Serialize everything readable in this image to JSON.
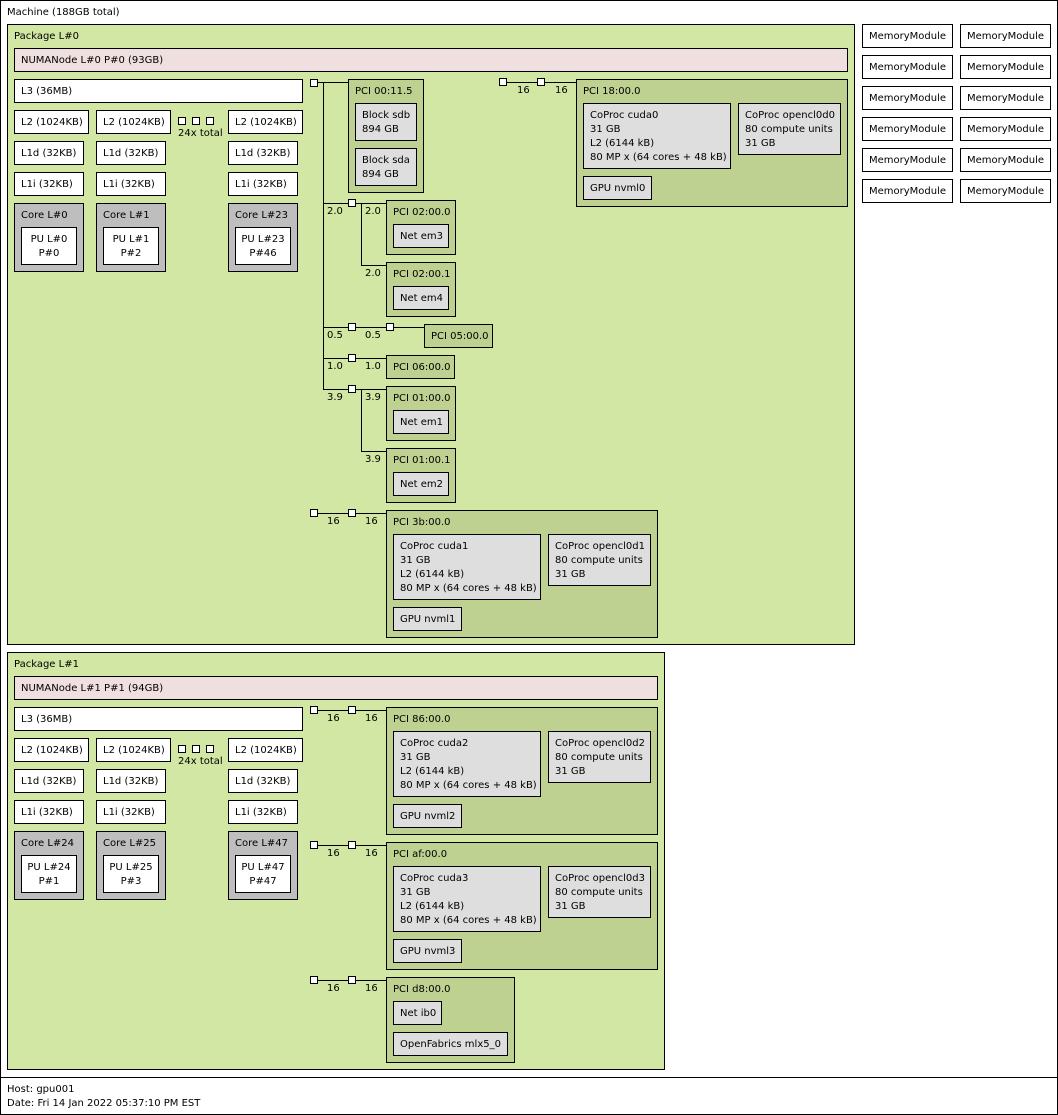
{
  "machine": {
    "title": "Machine (188GB total)"
  },
  "memory_modules": {
    "label": "MemoryModule"
  },
  "packages": [
    {
      "title": "Package L#0",
      "numa": "NUMANode L#0 P#0 (93GB)",
      "l3": "L3 (36MB)",
      "l2": [
        "L2 (1024KB)",
        "L2 (1024KB)",
        "L2 (1024KB)"
      ],
      "l1d": [
        "L1d (32KB)",
        "L1d (32KB)",
        "L1d (32KB)"
      ],
      "l1i": [
        "L1i (32KB)",
        "L1i (32KB)",
        "L1i (32KB)"
      ],
      "total": "24x total",
      "cores": [
        {
          "core": "Core L#0",
          "pu": "PU L#0",
          "p": "P#0"
        },
        {
          "core": "Core L#1",
          "pu": "PU L#1",
          "p": "P#2"
        },
        {
          "core": "Core L#23",
          "pu": "PU L#23",
          "p": "P#46"
        }
      ]
    },
    {
      "title": "Package L#1",
      "numa": "NUMANode L#1 P#1 (94GB)",
      "l3": "L3 (36MB)",
      "l2": [
        "L2 (1024KB)",
        "L2 (1024KB)",
        "L2 (1024KB)"
      ],
      "l1d": [
        "L1d (32KB)",
        "L1d (32KB)",
        "L1d (32KB)"
      ],
      "l1i": [
        "L1i (32KB)",
        "L1i (32KB)",
        "L1i (32KB)"
      ],
      "total": "24x total",
      "cores": [
        {
          "core": "Core L#24",
          "pu": "PU L#24",
          "p": "P#1"
        },
        {
          "core": "Core L#25",
          "pu": "PU L#25",
          "p": "P#3"
        },
        {
          "core": "Core L#47",
          "pu": "PU L#47",
          "p": "P#47"
        }
      ]
    }
  ],
  "pci": {
    "p0011": {
      "title": "PCI 00:11.5",
      "sdb": "Block sdb\n894 GB",
      "sda": "Block sda\n894 GB"
    },
    "p1800": {
      "title": "PCI 18:00.0",
      "cuda": "CoProc cuda0\n31 GB\nL2 (6144 kB)\n80 MP x (64 cores + 48 kB)",
      "opencl": "CoProc opencl0d0\n80 compute units\n31 GB",
      "gpu": "GPU nvml0"
    },
    "p0200": {
      "title": "PCI 02:00.0",
      "net": "Net em3"
    },
    "p0201": {
      "title": "PCI 02:00.1",
      "net": "Net em4"
    },
    "p0500": {
      "title": "PCI 05:00.0"
    },
    "p0600": {
      "title": "PCI 06:00.0"
    },
    "p0100": {
      "title": "PCI 01:00.0",
      "net": "Net em1"
    },
    "p0101": {
      "title": "PCI 01:00.1",
      "net": "Net em2"
    },
    "p3b00": {
      "title": "PCI 3b:00.0",
      "cuda": "CoProc cuda1\n31 GB\nL2 (6144 kB)\n80 MP x (64 cores + 48 kB)",
      "opencl": "CoProc opencl0d1\n80 compute units\n31 GB",
      "gpu": "GPU nvml1"
    },
    "p8600": {
      "title": "PCI 86:00.0",
      "cuda": "CoProc cuda2\n31 GB\nL2 (6144 kB)\n80 MP x (64 cores + 48 kB)",
      "opencl": "CoProc opencl0d2\n80 compute units\n31 GB",
      "gpu": "GPU nvml2"
    },
    "paf00": {
      "title": "PCI af:00.0",
      "cuda": "CoProc cuda3\n31 GB\nL2 (6144 kB)\n80 MP x (64 cores + 48 kB)",
      "opencl": "CoProc opencl0d3\n80 compute units\n31 GB",
      "gpu": "GPU nvml3"
    },
    "pd800": {
      "title": "PCI d8:00.0",
      "net": "Net ib0",
      "ofed": "OpenFabrics mlx5_0"
    }
  },
  "links": {
    "l2_0a": "2.0",
    "l2_0b": "2.0",
    "l2_0c": "2.0",
    "l0_5a": "0.5",
    "l0_5b": "0.5",
    "l1_0a": "1.0",
    "l1_0b": "1.0",
    "l3_9a": "3.9",
    "l3_9b": "3.9",
    "l3_9c": "3.9",
    "l16": "16"
  },
  "footer": {
    "host": "Host: gpu001",
    "date": "Date: Fri 14 Jan 2022 05:37:10 PM EST"
  }
}
